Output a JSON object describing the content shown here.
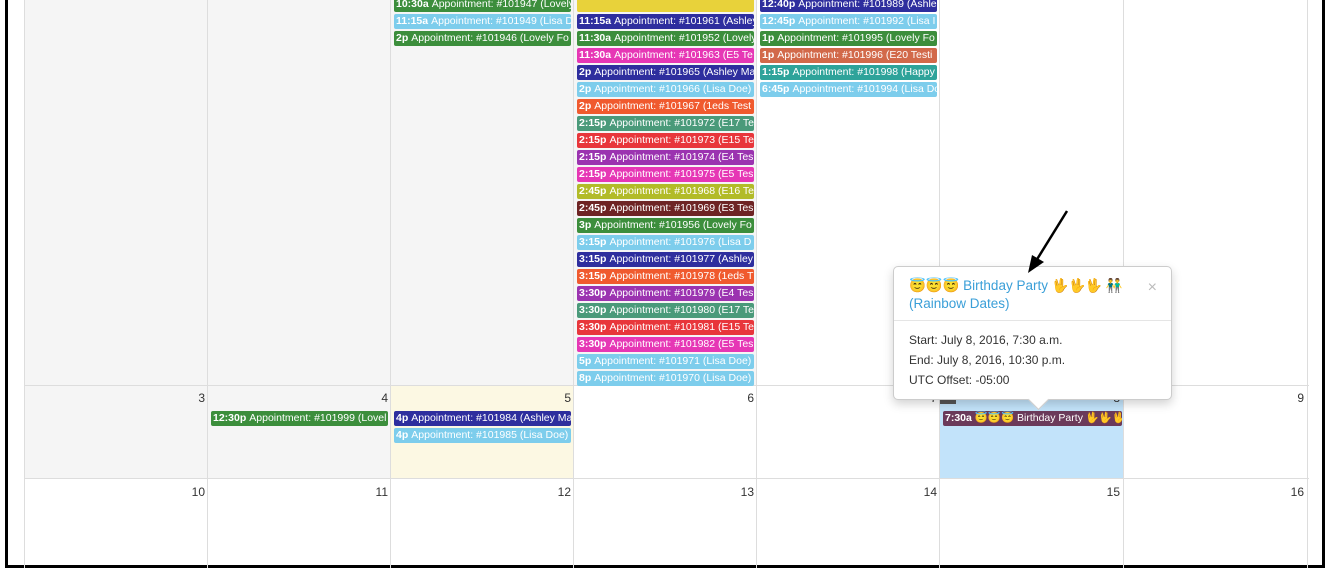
{
  "week2_events": {
    "thu": [
      {
        "time": "10:30a",
        "title": "Appointment: #101947 (Lovely",
        "color": "#3c8e3c"
      },
      {
        "time": "11:15a",
        "title": "Appointment: #101949 (Lisa D",
        "color": "#7dcdec"
      },
      {
        "time": "2p",
        "title": "Appointment: #101946 (Lovely Fo",
        "color": "#3c8e3c"
      }
    ],
    "fri": [
      {
        "time": "",
        "title": "",
        "color": "#e8d23a"
      },
      {
        "time": "11:15a",
        "title": "Appointment: #101961 (Ashley",
        "color": "#2e2e9e"
      },
      {
        "time": "11:30a",
        "title": "Appointment: #101952 (Lovely",
        "color": "#3c8e3c"
      },
      {
        "time": "11:30a",
        "title": "Appointment: #101963 (E5 Te",
        "color": "#e637b5"
      },
      {
        "time": "2p",
        "title": "Appointment: #101965 (Ashley Ma",
        "color": "#2e2e9e"
      },
      {
        "time": "2p",
        "title": "Appointment: #101966 (Lisa Doe)",
        "color": "#7dcdec"
      },
      {
        "time": "2p",
        "title": "Appointment: #101967 (1eds Test",
        "color": "#f05a2e"
      },
      {
        "time": "2:15p",
        "title": "Appointment: #101972 (E17 Te",
        "color": "#4a9a7a"
      },
      {
        "time": "2:15p",
        "title": "Appointment: #101973 (E15 Te",
        "color": "#e8363b"
      },
      {
        "time": "2:15p",
        "title": "Appointment: #101974 (E4 Tes",
        "color": "#9b33b0"
      },
      {
        "time": "2:15p",
        "title": "Appointment: #101975 (E5 Tes",
        "color": "#e637b5"
      },
      {
        "time": "2:45p",
        "title": "Appointment: #101968 (E16 Te",
        "color": "#b2bb28"
      },
      {
        "time": "2:45p",
        "title": "Appointment: #101969 (E3 Tes",
        "color": "#6e2424"
      },
      {
        "time": "3p",
        "title": "Appointment: #101956 (Lovely Fo",
        "color": "#3c8e3c"
      },
      {
        "time": "3:15p",
        "title": "Appointment: #101976 (Lisa D",
        "color": "#7dcdec"
      },
      {
        "time": "3:15p",
        "title": "Appointment: #101977 (Ashley",
        "color": "#2e2e9e"
      },
      {
        "time": "3:15p",
        "title": "Appointment: #101978 (1eds T",
        "color": "#f05a2e"
      },
      {
        "time": "3:30p",
        "title": "Appointment: #101979 (E4 Tes",
        "color": "#9b33b0"
      },
      {
        "time": "3:30p",
        "title": "Appointment: #101980 (E17 Te",
        "color": "#4a9a7a"
      },
      {
        "time": "3:30p",
        "title": "Appointment: #101981 (E15 Te",
        "color": "#e8363b"
      },
      {
        "time": "3:30p",
        "title": "Appointment: #101982 (E5 Tes",
        "color": "#e637b5"
      },
      {
        "time": "5p",
        "title": "Appointment: #101971 (Lisa Doe)",
        "color": "#7dcdec"
      },
      {
        "time": "8p",
        "title": "Appointment: #101970 (Lisa Doe)",
        "color": "#7dcdec"
      }
    ],
    "sat": [
      {
        "time": "12:40p",
        "title": "Appointment: #101989 (Ashle",
        "color": "#2e2e9e"
      },
      {
        "time": "12:45p",
        "title": "Appointment: #101992 (Lisa I",
        "color": "#7dcdec"
      },
      {
        "time": "1p",
        "title": "Appointment: #101995 (Lovely Fo",
        "color": "#3c8e3c"
      },
      {
        "time": "1p",
        "title": "Appointment: #101996 (E20 Testi",
        "color": "#d2694a"
      },
      {
        "time": "1:15p",
        "title": "Appointment: #101998 (Happy",
        "color": "#2ea39a"
      },
      {
        "time": "6:45p",
        "title": "Appointment: #101994 (Lisa Do",
        "color": "#7dcdec"
      }
    ]
  },
  "week3": {
    "day_numbers": [
      "3",
      "4",
      "5",
      "6",
      "7",
      "8",
      "9"
    ],
    "events": {
      "mon": [
        {
          "time": "12:30p",
          "title": "Appointment: #101999 (Lovel",
          "color": "#3c8e3c"
        }
      ],
      "tue": [
        {
          "time": "4p",
          "title": "Appointment: #101984 (Ashley Ma",
          "color": "#2e2e9e"
        },
        {
          "time": "4p",
          "title": "Appointment: #101985 (Lisa Doe)",
          "color": "#7dcdec"
        }
      ],
      "fri": [
        {
          "time": "7:30a",
          "title": "😇😇😇 Birthday Party 🖖🖖🖖 👬",
          "color": "#6b3a5a"
        }
      ]
    }
  },
  "week4": {
    "day_numbers": [
      "10",
      "11",
      "12",
      "13",
      "14",
      "15",
      "16"
    ]
  },
  "popover": {
    "title_line1": "😇😇😇 Birthday Party 🖖🖖🖖 👬",
    "title_line2": "(Rainbow Dates)",
    "close_symbol": "×",
    "start": "Start: July 8, 2016, 7:30 a.m.",
    "end": "End: July 8, 2016, 10:30 p.m.",
    "utc": "UTC Offset: -05:00"
  },
  "colors": {
    "today_bg": "#fcf8e3",
    "selected_bg": "#c2e3fa",
    "past_bg": "#f5f5f5"
  }
}
